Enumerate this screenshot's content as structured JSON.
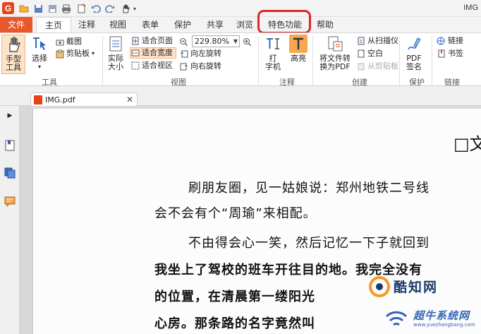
{
  "titlebar": {
    "window_title": "IMG",
    "logo": "G"
  },
  "menu": {
    "file": "文件",
    "tabs": [
      "主页",
      "注释",
      "视图",
      "表单",
      "保护",
      "共享",
      "浏览",
      "特色功能",
      "帮助"
    ]
  },
  "ribbon": {
    "tools": {
      "hand": "手型\n工具",
      "select": "选择",
      "screenshot": "截图",
      "clipboard": "剪贴板",
      "group": "工具"
    },
    "view": {
      "actual_size": "实际\n大小",
      "fit_page": "适合页面",
      "fit_width": "适合宽度",
      "fit_view": "适合视区",
      "zoom": "229.80%",
      "rotate_left": "向左旋转",
      "rotate_right": "向右旋转",
      "group": "视图"
    },
    "comment": {
      "typewriter": "打\n字机",
      "highlight": "高亮",
      "group": "注释"
    },
    "create": {
      "convert": "将文件转\n换为PDF",
      "from_scanner": "从扫描仪",
      "blank": "空白",
      "from_clipboard": "从剪贴板",
      "group": "创建"
    },
    "protect": {
      "pdf_sign": "PDF\n签名",
      "group": "保护"
    },
    "links": {
      "link": "链接",
      "bookmark": "书签",
      "group": "链接"
    }
  },
  "document": {
    "tab_name": "IMG.pdf",
    "heading": "□文",
    "lines": [
      "刷朋友圈，见一姑娘说：郑州地铁二号线",
      "会不会有个“周瑜”来相配。",
      "不由得会心一笑，然后记忆一下子就回到",
      "我坐上了驾校的班车开往目的地。我完全没有",
      "的位置，在清晨第一缕阳光",
      "心房。那条路的名字竟然叫"
    ]
  },
  "watermark": {
    "site1": "酷知网",
    "site2": "超牛系统网",
    "site2_url": "www.yuezhangbang.com"
  },
  "colors": {
    "file_tab": "#e8582b",
    "highlight_ring": "#d8262c",
    "selected_btn": "#fde3c8",
    "accent_orange": "#f0a04b"
  }
}
